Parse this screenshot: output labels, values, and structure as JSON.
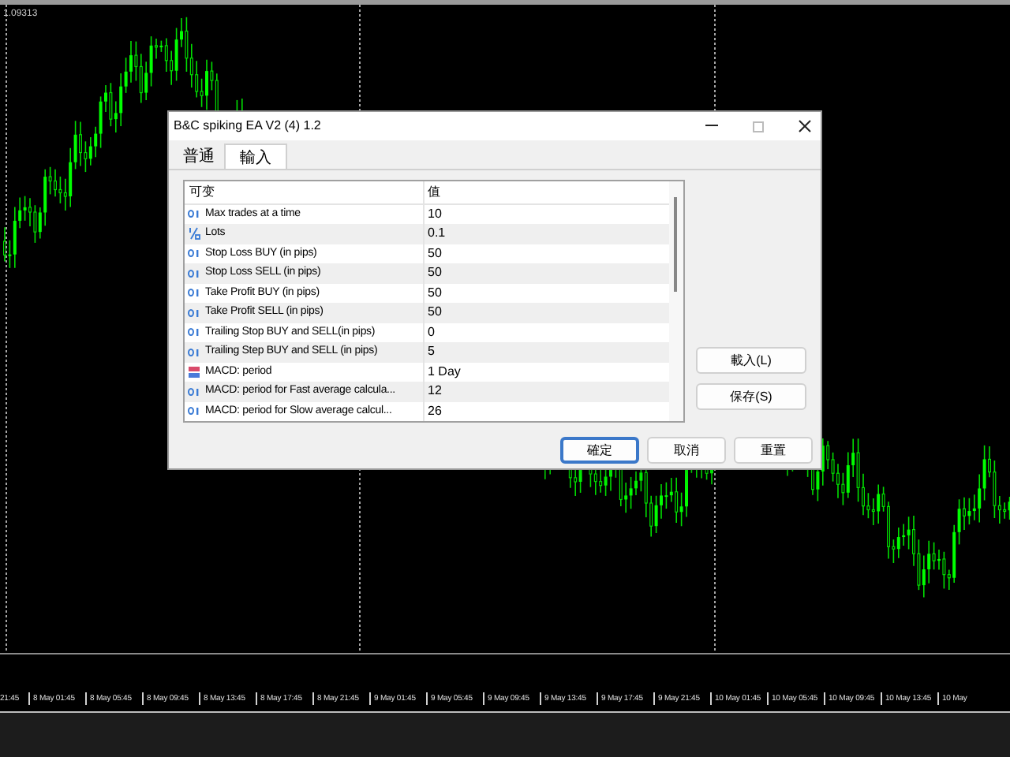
{
  "chart": {
    "price_label": "1.09313",
    "time_labels": [
      "21:45",
      "8 May 01:45",
      "8 May 05:45",
      "8 May 09:45",
      "8 May 13:45",
      "8 May 17:45",
      "8 May 21:45",
      "9 May 01:45",
      "9 May 05:45",
      "9 May 09:45",
      "9 May 13:45",
      "9 May 17:45",
      "9 May 21:45",
      "10 May 01:45",
      "10 May 05:45",
      "10 May 09:45",
      "10 May 13:45",
      "10 May"
    ]
  },
  "dialog": {
    "title": "B&C spiking EA V2 (4) 1.2",
    "tabs": [
      {
        "label": "普通",
        "selected": false
      },
      {
        "label": "輸入",
        "selected": true
      }
    ],
    "table": {
      "columns": [
        "可变",
        "值"
      ],
      "rows": [
        {
          "kind": "int",
          "name": "Max trades at a time",
          "value": "10"
        },
        {
          "kind": "double",
          "name": "Lots",
          "value": "0.1"
        },
        {
          "kind": "int",
          "name": "Stop Loss BUY (in pips)",
          "value": "50"
        },
        {
          "kind": "int",
          "name": "Stop Loss SELL (in pips)",
          "value": "50"
        },
        {
          "kind": "int",
          "name": "Take Profit BUY (in pips)",
          "value": "50"
        },
        {
          "kind": "int",
          "name": "Take Profit SELL (in pips)",
          "value": "50"
        },
        {
          "kind": "int",
          "name": "Trailing Stop BUY and SELL(in pips)",
          "value": "0"
        },
        {
          "kind": "int",
          "name": "Trailing Step BUY and SELL (in pips)",
          "value": "5"
        },
        {
          "kind": "enum",
          "name": "MACD: period",
          "value": "1 Day"
        },
        {
          "kind": "int",
          "name": "MACD: period for Fast average calcula...",
          "value": "12"
        },
        {
          "kind": "int",
          "name": "MACD: period for Slow average calcul...",
          "value": "26"
        }
      ]
    },
    "side_buttons": [
      "載入(L)",
      "保存(S)"
    ],
    "buttons": [
      {
        "label": "確定",
        "default": true
      },
      {
        "label": "取消",
        "default": false
      },
      {
        "label": "重置",
        "default": false
      }
    ]
  }
}
